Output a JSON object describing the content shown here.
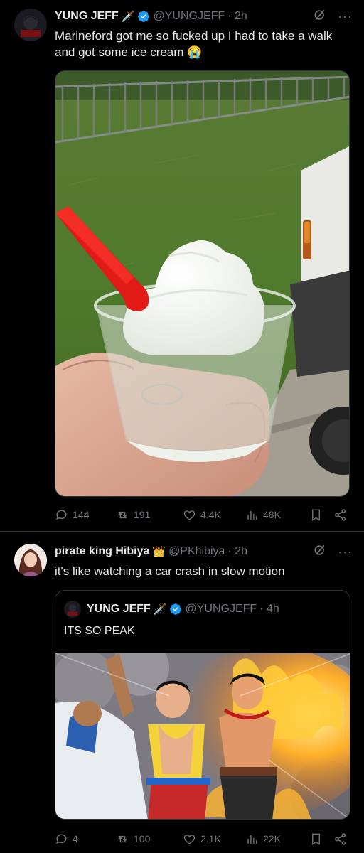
{
  "tweets": [
    {
      "author": {
        "name": "YUNG JEFF",
        "emoji": "🗡️",
        "handle": "@YUNGJEFF",
        "time": "· 2h"
      },
      "text": "Marineford got me so fucked up I had to take a walk and got some ice cream 😭",
      "stats": {
        "replies": "144",
        "retweets": "191",
        "likes": "4.4K",
        "views": "48K"
      }
    },
    {
      "author": {
        "name": "pirate king Hibiya",
        "emoji": "👑",
        "handle": "@PKhibiya",
        "time": "· 2h"
      },
      "text": "it's like watching a car crash in slow motion",
      "quote": {
        "name": "YUNG JEFF",
        "emoji": "🗡️",
        "handle": "@YUNGJEFF",
        "time": "· 4h",
        "text": "ITS SO PEAK"
      },
      "stats": {
        "replies": "4",
        "retweets": "100",
        "likes": "2.1K",
        "views": "22K"
      }
    }
  ],
  "colors": {
    "background": "#000000",
    "verified": "#1d9bf0",
    "muted": "#71767b",
    "border": "#2f3336"
  },
  "icons": [
    "verified-icon",
    "grok-icon",
    "more-icon",
    "reply-icon",
    "retweet-icon",
    "like-icon",
    "views-icon",
    "bookmark-icon",
    "share-icon"
  ]
}
